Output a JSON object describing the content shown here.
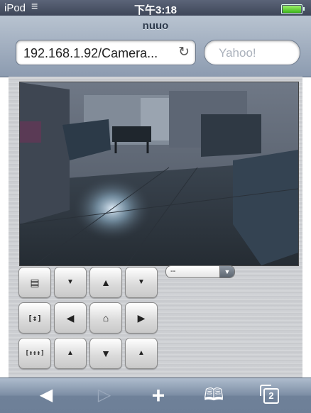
{
  "status": {
    "carrier": "iPod",
    "time": "下午3:18"
  },
  "browser": {
    "page_title": "nuuo",
    "url": "192.168.1.92/Camera...",
    "search_placeholder": "Yahoo!"
  },
  "ptz": {
    "preset_value": "--"
  },
  "icons": {
    "wifi": "wifi-icon",
    "battery": "battery-icon",
    "reload": "reload-icon",
    "menu": "list-icon",
    "zoom": "zoom-icon",
    "focus": "focus-icon",
    "home": "home-icon",
    "bookmarks": "open-book-icon",
    "tabs": "tabs-icon"
  },
  "toolbar": {
    "tab_count": "2"
  }
}
